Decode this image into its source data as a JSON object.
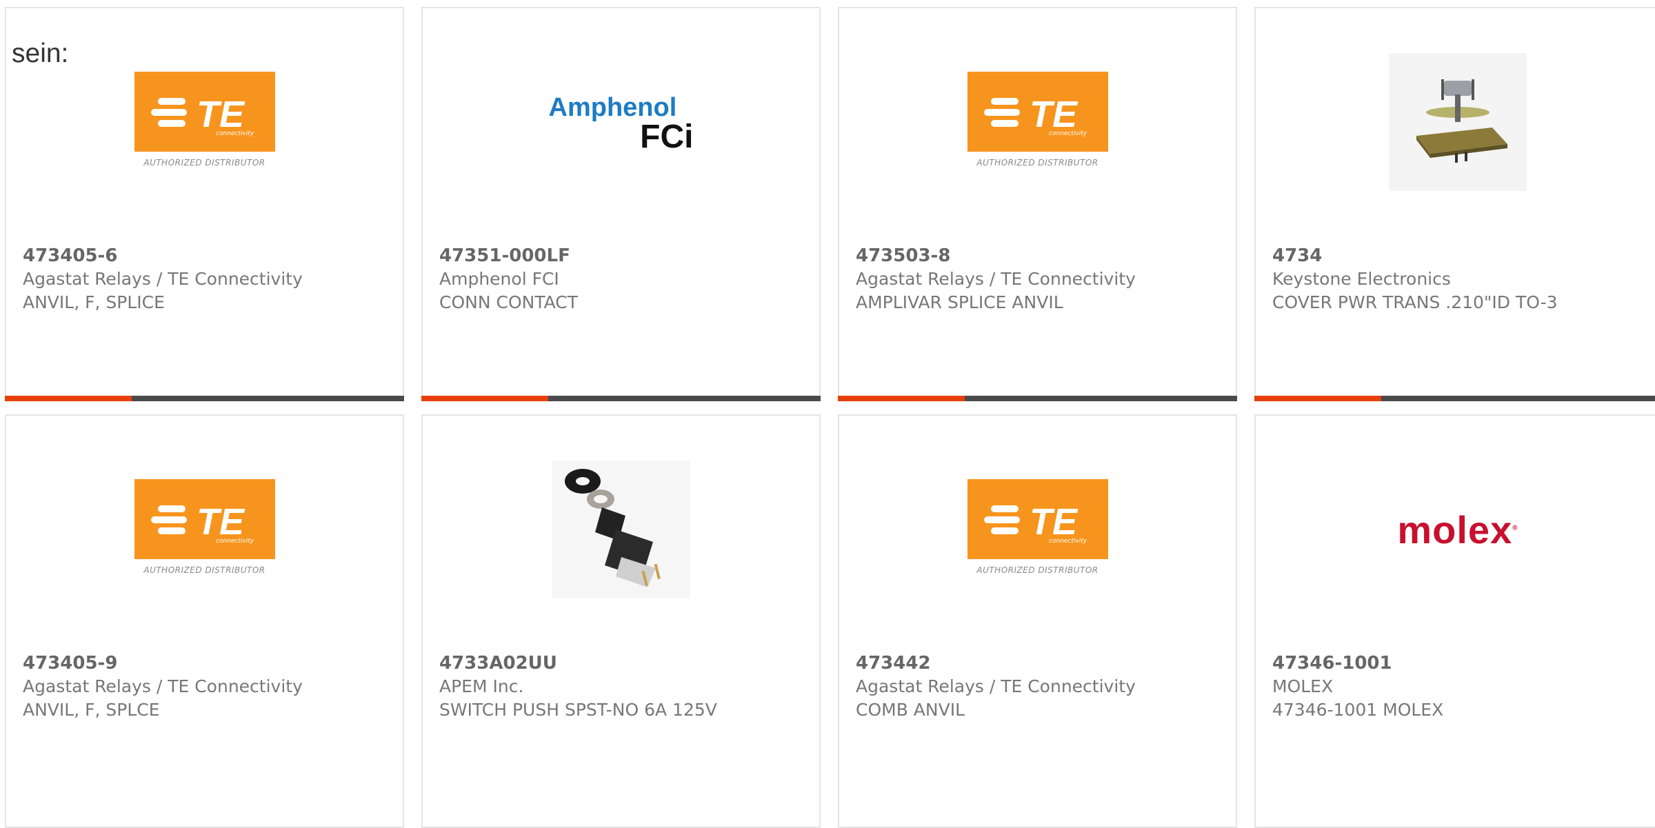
{
  "intro_text": "sein:",
  "te_logo": {
    "text": "TE",
    "subtext": "connectivity",
    "caption": "AUTHORIZED DISTRIBUTOR"
  },
  "amphenol_logo": {
    "line1": "Amphenol",
    "line2": "FCi"
  },
  "molex_logo": {
    "text": "molex",
    "mark": "®"
  },
  "colors": {
    "accent": "#e8400c",
    "bar": "#4a4a4a",
    "te_orange": "#f7941d"
  },
  "cards": [
    {
      "part": "473405-6",
      "manufacturer": "Agastat Relays / TE Connectivity",
      "description": "ANVIL, F, SPLICE",
      "image": "te-logo"
    },
    {
      "part": "47351-000LF",
      "manufacturer": "Amphenol FCI",
      "description": "CONN CONTACT",
      "image": "amphenol-logo"
    },
    {
      "part": "473503-8",
      "manufacturer": "Agastat Relays / TE Connectivity",
      "description": "AMPLIVAR SPLICE ANVIL",
      "image": "te-logo"
    },
    {
      "part": "4734",
      "manufacturer": "Keystone Electronics",
      "description": "COVER PWR TRANS .210\"ID TO-3",
      "image": "product-photo"
    },
    {
      "part": "473405-9",
      "manufacturer": "Agastat Relays / TE Connectivity",
      "description": "ANVIL, F, SPLCE",
      "image": "te-logo"
    },
    {
      "part": "4733A02UU",
      "manufacturer": "APEM Inc.",
      "description": "SWITCH PUSH SPST-NO 6A 125V",
      "image": "product-photo"
    },
    {
      "part": "473442",
      "manufacturer": "Agastat Relays / TE Connectivity",
      "description": "COMB ANVIL",
      "image": "te-logo"
    },
    {
      "part": "47346-1001",
      "manufacturer": "MOLEX",
      "description": "47346-1001 MOLEX",
      "image": "molex-logo"
    }
  ]
}
